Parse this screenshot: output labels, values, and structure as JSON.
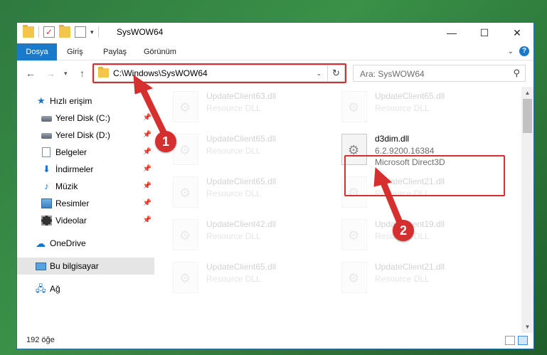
{
  "window": {
    "title": "SysWOW64",
    "controls": {
      "minimize": "—",
      "maximize": "☐",
      "close": "✕"
    }
  },
  "ribbon": {
    "tabs": [
      "Dosya",
      "Giriş",
      "Paylaş",
      "Görünüm"
    ],
    "help": "?"
  },
  "address": {
    "path": "C:\\Windows\\SysWOW64",
    "search_placeholder": "Ara: SysWOW64"
  },
  "nav": {
    "items": [
      {
        "label": "Hızlı erişim",
        "icon": "star-icon",
        "pinned": false
      },
      {
        "label": "Yerel Disk (C:)",
        "icon": "drive-icon",
        "pinned": true
      },
      {
        "label": "Yerel Disk (D:)",
        "icon": "drive-icon",
        "pinned": true
      },
      {
        "label": "Belgeler",
        "icon": "documents-icon",
        "pinned": true
      },
      {
        "label": "İndirmeler",
        "icon": "download-icon",
        "pinned": true
      },
      {
        "label": "Müzik",
        "icon": "music-icon",
        "pinned": true
      },
      {
        "label": "Resimler",
        "icon": "pictures-icon",
        "pinned": true
      },
      {
        "label": "Videolar",
        "icon": "video-icon",
        "pinned": true
      },
      {
        "label": "OneDrive",
        "icon": "cloud-icon",
        "pinned": false
      },
      {
        "label": "Bu bilgisayar",
        "icon": "computer-icon",
        "pinned": false,
        "selected": true
      },
      {
        "label": "Ağ",
        "icon": "network-icon",
        "pinned": false
      }
    ]
  },
  "files": [
    {
      "name": "UpdateClient63.dll",
      "type": "Resource DLL",
      "faded": true
    },
    {
      "name": "UpdateClient65.dll",
      "type": "Resource DLL",
      "faded": true
    },
    {
      "name": "UpdateClient65.dll",
      "type": "Resource DLL",
      "faded": true
    },
    {
      "name": "d3dim.dll",
      "version": "6.2.9200.16384",
      "type": "Microsoft Direct3D",
      "faded": false
    },
    {
      "name": "UpdateClient65.dll",
      "type": "Resource DLL",
      "faded": true
    },
    {
      "name": "UpdateClient21.dll",
      "type": "Resource DLL",
      "faded": true
    },
    {
      "name": "UpdateClient42.dll",
      "type": "Resource DLL",
      "faded": true
    },
    {
      "name": "UpdateClient19.dll",
      "type": "Resource DLL",
      "faded": true
    },
    {
      "name": "UpdateClient65.dll",
      "type": "Resource DLL",
      "faded": true
    },
    {
      "name": "UpdateClient21.dll",
      "type": "Resource DLL",
      "faded": true
    }
  ],
  "status": {
    "item_count": "192 öğe"
  },
  "annotations": {
    "step1": "1",
    "step2": "2",
    "color": "#d62f2f"
  }
}
